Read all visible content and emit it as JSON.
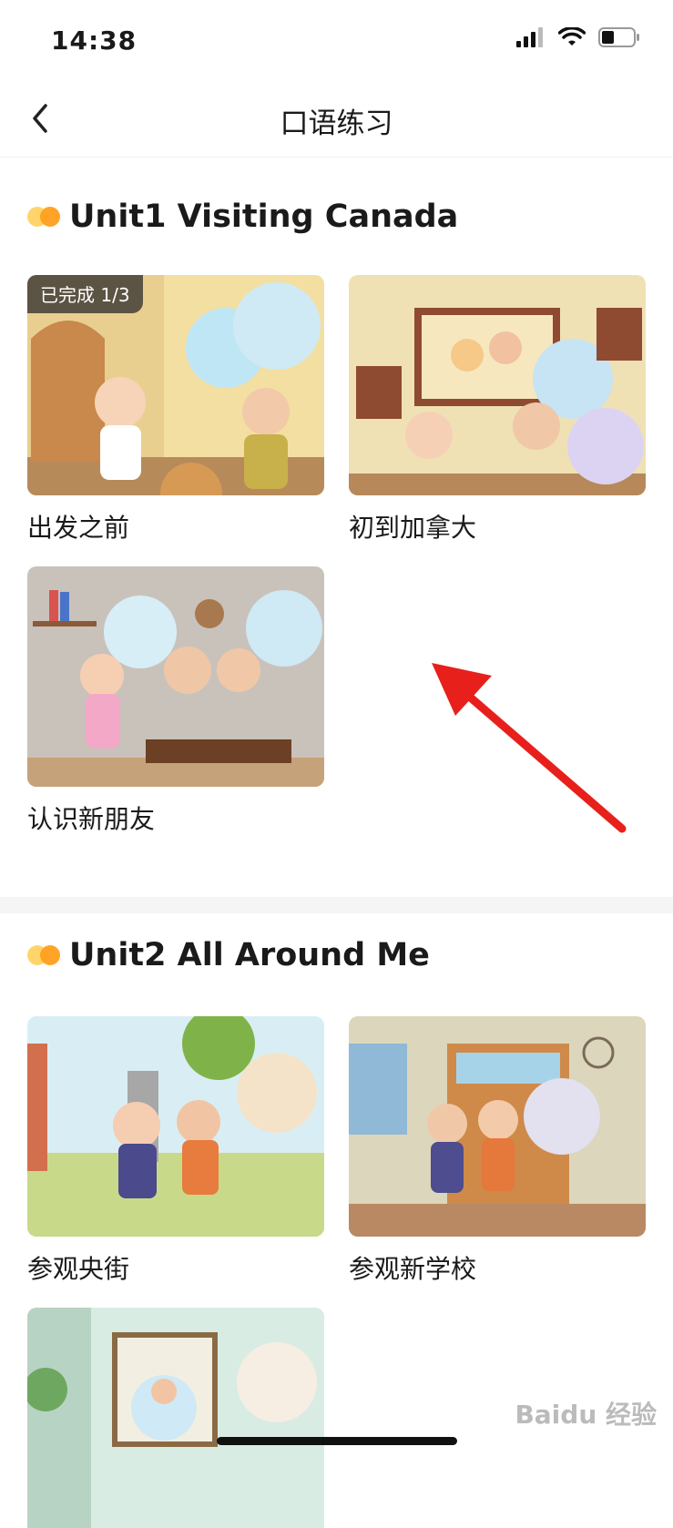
{
  "status": {
    "time": "14:38"
  },
  "nav": {
    "title": "口语练习"
  },
  "units": [
    {
      "title": "Unit1 Visiting Canada",
      "cards": [
        {
          "label": "出发之前",
          "badge": "已完成 1/3"
        },
        {
          "label": "初到加拿大"
        },
        {
          "label": "认识新朋友"
        }
      ]
    },
    {
      "title": "Unit2 All Around Me",
      "cards": [
        {
          "label": "参观央街"
        },
        {
          "label": "参观新学校"
        }
      ]
    }
  ],
  "watermark": "Baidu 经验",
  "colors": {
    "dot_left": "#ffd56b",
    "dot_right": "#ff9f1c",
    "arrow": "#e8201b"
  },
  "icons": [
    "back-arrow",
    "signal-icon",
    "wifi-icon",
    "battery-icon"
  ]
}
